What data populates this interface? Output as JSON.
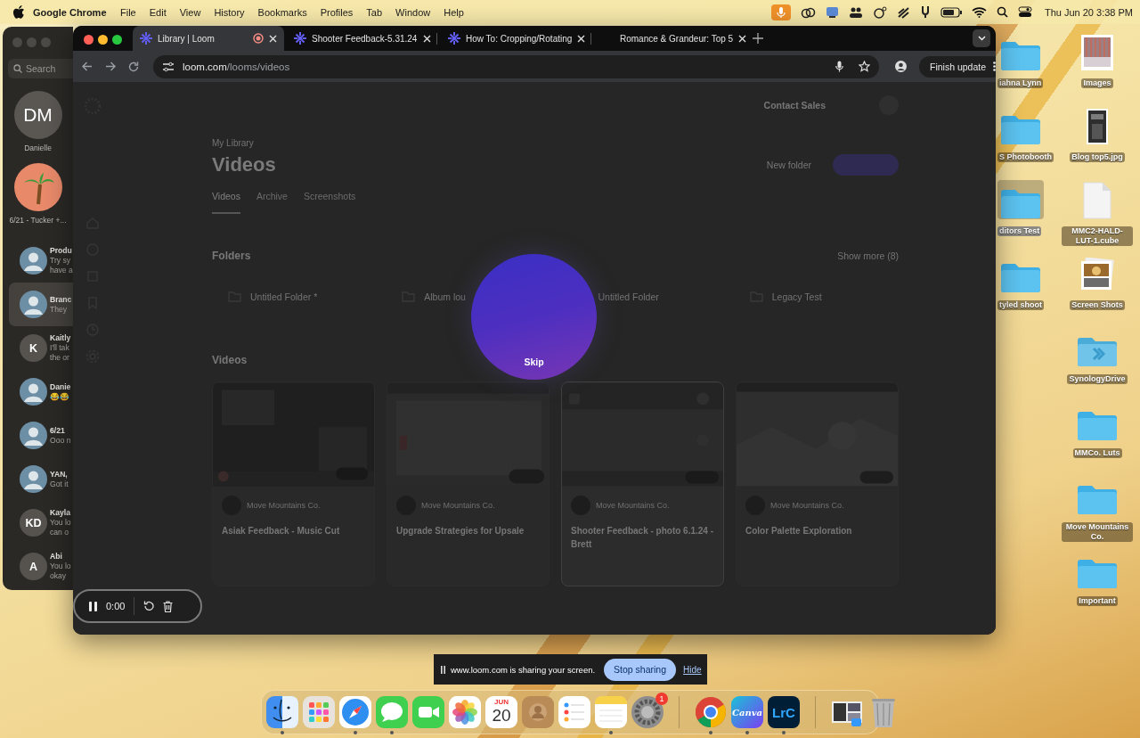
{
  "menubar": {
    "app_name": "Google Chrome",
    "menus": [
      "File",
      "Edit",
      "View",
      "History",
      "Bookmarks",
      "Profiles",
      "Tab",
      "Window",
      "Help"
    ],
    "date": "Thu Jun 20",
    "time": "3:38 PM"
  },
  "messages_window": {
    "search_placeholder": "Search",
    "pinned": [
      {
        "kind": "initials",
        "initials": "DM",
        "name": "Danielle"
      },
      {
        "kind": "picture",
        "name": "6/21 - Tucker +..."
      }
    ],
    "conversations": [
      {
        "kind": "picture",
        "title": "Produ",
        "preview": [
          "Try sy",
          "have a"
        ],
        "selected": false
      },
      {
        "kind": "picture",
        "title": "Branc",
        "preview": [
          "They"
        ],
        "selected": true
      },
      {
        "kind": "initials",
        "initials": "K",
        "title": "Kaitly",
        "preview": [
          "I'll tak",
          "the or"
        ],
        "selected": false
      },
      {
        "kind": "picture",
        "title": "Danie",
        "preview": [
          "😂😂"
        ],
        "selected": false
      },
      {
        "kind": "picture",
        "title": "6/21",
        "preview": [
          "Ooo n"
        ],
        "selected": false
      },
      {
        "kind": "picture",
        "title": "YAN,",
        "preview": [
          "Got it"
        ],
        "selected": false
      },
      {
        "kind": "initials",
        "initials": "KD",
        "title": "Kayla",
        "preview": [
          "You lo",
          "can o"
        ],
        "selected": false
      },
      {
        "kind": "initials",
        "initials": "A",
        "title": "Abi",
        "preview": [
          "You lo",
          "okay"
        ],
        "selected": false
      }
    ]
  },
  "browser": {
    "tabs": [
      {
        "title": "Library | Loom",
        "selected": true,
        "recording": true,
        "favicon": true
      },
      {
        "title": "Shooter Feedback-5.31.24",
        "selected": false,
        "recording": false,
        "favicon": true
      },
      {
        "title": "How To: Cropping/Rotating",
        "selected": false,
        "recording": false,
        "favicon": true
      },
      {
        "title": "Romance & Grandeur: Top 5",
        "selected": false,
        "recording": false,
        "favicon": false
      }
    ],
    "url_host": "loom.com",
    "url_path": "/looms/videos",
    "update_button": "Finish update",
    "page": {
      "header_link": "Contact Sales",
      "breadcrumb": "My Library",
      "title": "Videos",
      "new_folder": "New folder",
      "tabs": [
        {
          "label": "Videos",
          "selected": true
        },
        {
          "label": "Archive",
          "selected": false
        },
        {
          "label": "Screenshots",
          "selected": false
        }
      ],
      "folders_heading": "Folders",
      "show_more": "Show more (8)",
      "folders": [
        "Untitled Folder *",
        "Album lou",
        "Untitled Folder",
        "Legacy Test"
      ],
      "videos_heading": "Videos",
      "videos": [
        {
          "author": "Move Mountains Co.",
          "title": "Asiak Feedback - Music Cut",
          "highlighted": false
        },
        {
          "author": "Move Mountains Co.",
          "title": "Upgrade Strategies for Upsale",
          "highlighted": false
        },
        {
          "author": "Move Mountains Co.",
          "title": "Shooter Feedback - photo 6.1.24 - Brett",
          "highlighted": true
        },
        {
          "author": "Move Mountains Co.",
          "title": "Color Palette Exploration",
          "highlighted": false
        }
      ]
    },
    "skip_button": "Skip",
    "recorder": {
      "time": "0:00"
    }
  },
  "desktop": {
    "left_column": [
      {
        "kind": "folder",
        "label": "iahna Lynn",
        "selected": false
      },
      {
        "kind": "folder",
        "label": "S Photobooth",
        "selected": false
      },
      {
        "kind": "folder",
        "label": "ditors Test",
        "selected": true
      },
      {
        "kind": "folder",
        "label": "tyled shoot",
        "selected": false
      }
    ],
    "right_column": [
      {
        "label": "Images",
        "selected": false
      },
      {
        "kind": "document",
        "label": "Blog top5.jpg",
        "selected": false
      },
      {
        "kind": "file",
        "label": "MMC2-HALD-LUT-1.cube",
        "selected": false
      },
      {
        "kind": "stack",
        "label": "Screen Shots",
        "selected": false
      },
      {
        "kind": "synology",
        "label": "SynologyDrive",
        "selected": false
      },
      {
        "kind": "folder",
        "label": "MMCo. Luts",
        "selected": false
      },
      {
        "kind": "folder",
        "label": "Move Mountains Co.",
        "selected": false
      },
      {
        "kind": "folder",
        "label": "Important",
        "selected": false
      }
    ]
  },
  "share_bar": {
    "message": "www.loom.com is sharing your screen.",
    "stop_button": "Stop sharing",
    "hide_link": "Hide"
  },
  "dock": {
    "apps": [
      {
        "kind": "finder",
        "running": true
      },
      {
        "kind": "launchpad",
        "running": false
      },
      {
        "kind": "safari",
        "running": true
      },
      {
        "kind": "messages",
        "running": true
      },
      {
        "kind": "facetime",
        "running": false
      },
      {
        "kind": "photos",
        "running": false
      },
      {
        "kind": "calendar",
        "month": "JUN",
        "day": "20",
        "running": false
      },
      {
        "kind": "contacts",
        "running": false
      },
      {
        "kind": "reminders",
        "running": false
      },
      {
        "kind": "notes",
        "running": true
      },
      {
        "kind": "settings",
        "badge": "1",
        "running": false
      },
      {
        "kind": "separator"
      },
      {
        "kind": "chrome",
        "running": true
      },
      {
        "kind": "canva",
        "text": "Canva",
        "running": true
      },
      {
        "kind": "lightroom",
        "text": "LrC",
        "running": true
      },
      {
        "kind": "separator"
      },
      {
        "kind": "screenshot-stack",
        "running": false
      },
      {
        "kind": "trash",
        "running": false
      }
    ]
  }
}
